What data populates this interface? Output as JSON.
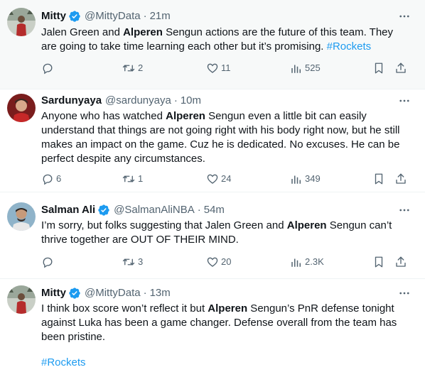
{
  "tweets": [
    {
      "name": "Mitty",
      "handle": "@MittyData",
      "sep": "·",
      "time": "21m",
      "verified": true,
      "text": [
        {
          "t": "Jalen Green and ",
          "b": false
        },
        {
          "t": "Alperen",
          "b": true
        },
        {
          "t": " Sengun actions are the future of this team. They are going to take time learning each other but it’s promising. ",
          "b": false
        },
        {
          "t": "#Rockets",
          "tag": true
        }
      ],
      "replies": "",
      "retweets": "2",
      "likes": "11",
      "views": "525"
    },
    {
      "name": "Sardunyaya",
      "handle": "@sardunyaya",
      "sep": "·",
      "time": "10m",
      "verified": false,
      "text": [
        {
          "t": "Anyone who has watched ",
          "b": false
        },
        {
          "t": "Alperen",
          "b": true
        },
        {
          "t": " Sengun even a little bit can easily understand that things are not going right with his body right now, but he still makes an impact on the game. Cuz he is dedicated. No excuses. He can be perfect despite any circumstances.",
          "b": false
        }
      ],
      "replies": "6",
      "retweets": "1",
      "likes": "24",
      "views": "349"
    },
    {
      "name": "Salman Ali",
      "handle": "@SalmanAliNBA",
      "sep": "·",
      "time": "54m",
      "verified": true,
      "text": [
        {
          "t": "I’m sorry, but folks suggesting that Jalen Green and ",
          "b": false
        },
        {
          "t": "Alperen",
          "b": true
        },
        {
          "t": " Sengun can’t thrive together are OUT OF THEIR MIND.",
          "b": false
        }
      ],
      "replies": "",
      "retweets": "3",
      "likes": "20",
      "views": "2.3K"
    },
    {
      "name": "Mitty",
      "handle": "@MittyData",
      "sep": "·",
      "time": "13m",
      "verified": true,
      "text": [
        {
          "t": "I think box score won’t reflect it but ",
          "b": false
        },
        {
          "t": "Alperen",
          "b": true
        },
        {
          "t": " Sengun’s PnR defense tonight against Luka has been a game changer. Defense overall from the team has been pristine.",
          "b": false
        }
      ],
      "hashtag_line": "#Rockets"
    }
  ],
  "colors": {
    "verified": "#1d9bf0",
    "secondary_text": "#536471",
    "hashtag": "#1d9bf0",
    "highlighted_bg": "#f7f9f9"
  },
  "icons": [
    "verified-badge-icon",
    "more-icon",
    "reply-icon",
    "retweet-icon",
    "like-icon",
    "views-icon",
    "bookmark-icon",
    "share-icon"
  ]
}
